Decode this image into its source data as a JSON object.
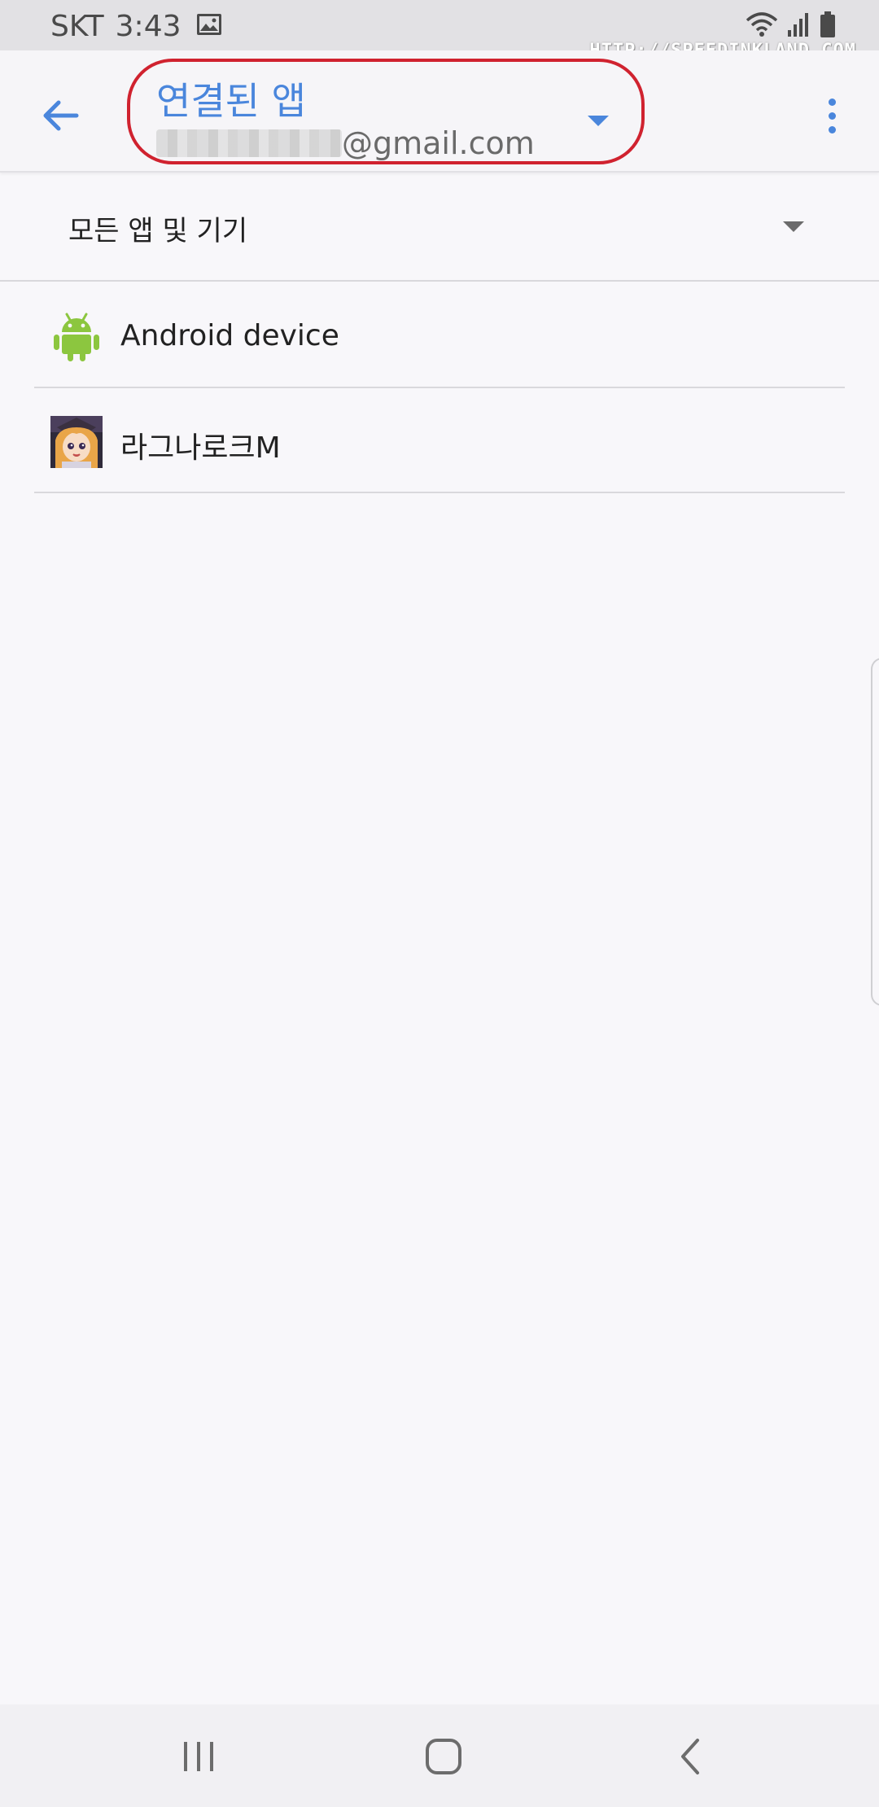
{
  "status_bar": {
    "carrier": "SKT",
    "time": "3:43",
    "watermark": "HTTP://SPEEDINKLAND.COM",
    "icons": [
      "gallery-notification-icon",
      "wifi-icon",
      "signal-icon",
      "battery-icon"
    ]
  },
  "app_bar": {
    "title": "연결된 앱",
    "account_domain": "@gmail.com",
    "accent_color": "#4a86dc",
    "highlight_color": "#d0222f",
    "icons": [
      "back-arrow-icon",
      "dropdown-caret-icon",
      "more-vert-icon"
    ]
  },
  "filter": {
    "label": "모든 앱 및 기기",
    "icon": "dropdown-caret-icon"
  },
  "apps": [
    {
      "name": "Android device",
      "icon": "android-robot-icon"
    },
    {
      "name": "라그나로크M",
      "icon": "ragnarok-m-app-icon"
    }
  ],
  "nav_bar": {
    "icons": [
      "recent-apps-icon",
      "home-icon",
      "back-icon"
    ]
  }
}
